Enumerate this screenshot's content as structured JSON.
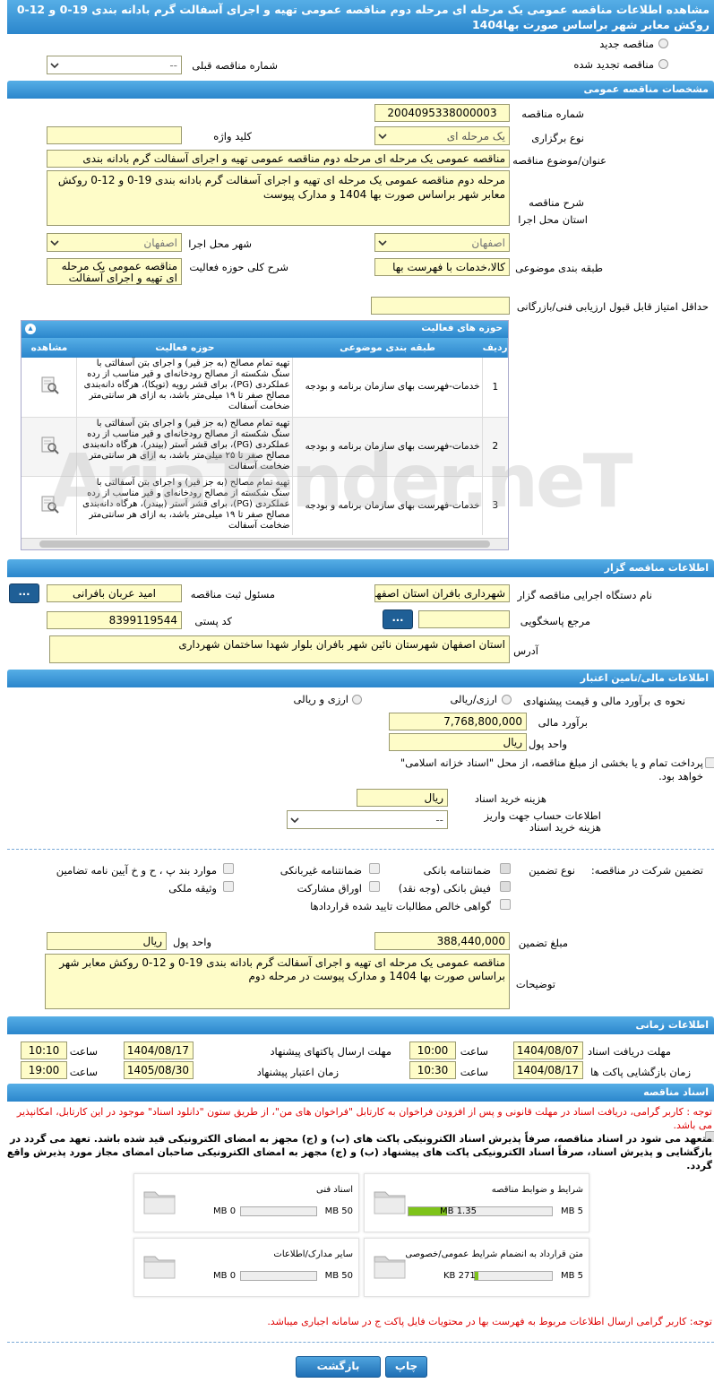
{
  "title": "مشاهده اطلاعات مناقصه عمومی یک مرحله ای مرحله دوم مناقصه عمومی تهیه و اجرای آسفالت گرم بادانه بندی 19-0 و 12-0 روکش معابر شهر براساس صورت بها1404",
  "top": {
    "new_label": "مناقصه جدید",
    "renewed_label": "مناقصه تجدید شده",
    "prev_label": "شماره مناقصه قبلی",
    "prev_value": "--"
  },
  "general": {
    "header": "مشخصات مناقصه عمومی",
    "number_label": "شماره مناقصه",
    "number": "2004095338000003",
    "type_label": "نوع برگزاری",
    "type": "یک مرحله ای",
    "keyword_label": "کلید واژه",
    "subject_label": "عنوان/موضوع مناقصه",
    "subject": "مناقصه عمومی یک مرحله ای مرحله دوم مناقصه عمومی تهیه و اجرای آسفالت گرم بادانه بندی",
    "desc_label": "شرح مناقصه",
    "desc": "مرحله دوم مناقصه عمومی یک مرحله ای تهیه و اجرای آسفالت گرم بادانه بندی 19-0 و 12-0 روکش معابر شهر براساس صورت بها 1404 و مدارک پیوست",
    "province_label": "استان محل اجرا",
    "province": "اصفهان",
    "city_label": "شهر محل اجرا",
    "city": "اصفهان",
    "category_label": "طبقه بندی موضوعی",
    "category": "کالا،خدمات با فهرست بها",
    "scope_label": "شرح کلی حوزه فعالیت",
    "scope": "مناقصه عمومی یک مرحله ای تهیه و اجرای آسفالت",
    "min_score_label": "حداقل امتیاز قابل قبول ارزیابی فنی/بازرگانی"
  },
  "activity": {
    "header": "حوزه های فعالیت",
    "col_row": "ردیف",
    "col_cat": "طبقه بندی موضوعی",
    "col_area": "حوزه فعالیت",
    "col_view": "مشاهده",
    "rows": [
      {
        "n": "1",
        "cat": "خدمات-فهرست بهای سازمان برنامه و بودجه",
        "area": "تهیه تمام مصالح (به جز قیر) و اجرای بتن آسفالتی با سنگ شکسته از مصالح رودخانه‌ای و قیر مناسب از رده عملکردی (PG)، برای قشر رویه (توپکا)، هرگاه دانه‌بندی مصالح صفر تا ۱۹ میلی‌متر باشد، به ازای هر سانتی‌متر ضخامت آسفالت"
      },
      {
        "n": "2",
        "cat": "خدمات-فهرست بهای سازمان برنامه و بودجه",
        "area": "تهیه تمام مصالح (به جز قیر) و اجرای بتن آسفالتی با سنگ شکسته از مصالح رودخانه‌ای و قیر مناسب از رده عملکردی (PG)، برای قشر آستر (بیندر)، هرگاه دانه‌بندی مصالح صفر تا ۲۵ میلی‌متر باشد، به ازای هر سانتی‌متر ضخامت آسفالت"
      },
      {
        "n": "3",
        "cat": "خدمات-فهرست بهای سازمان برنامه و بودجه",
        "area": "تهیه تمام مصالح (به جز قیر) و اجرای بتن آسفالتی با سنگ شکسته از مصالح رودخانه‌ای و قیر مناسب از رده عملکردی (PG)، برای قشر آستر (بیندر)، هرگاه دانه‌بندی مصالح صفر تا ۱۹ میلی‌متر باشد، به ازای هر سانتی‌متر ضخامت آسفالت"
      }
    ]
  },
  "organizer": {
    "header": "اطلاعات مناقصه گزار",
    "org_label": "نام دستگاه اجرایی مناقصه گزار",
    "org": "شهرداری بافران استان اصفهان",
    "resp_label": "مسئول ثبت مناقصه",
    "resp": "امید عربان بافرانی",
    "ref_label": "مرجع پاسخگویی",
    "postal_label": "کد پستی",
    "postal": "8399119544",
    "addr_label": "آدرس",
    "addr": "استان اصفهان شهرستان نائین شهر بافران بلوار شهدا ساختمان شهرداری",
    "dots": "..."
  },
  "finance": {
    "header": "اطلاعات مالی/تامین اعتبار",
    "method_label": "نحوه ی برآورد مالی و قیمت پیشنهادی",
    "opt1": "ارزی/ریالی",
    "opt2": "ارزی و ریالی",
    "estimate_label": "برآورد مالی",
    "estimate": "7,768,800,000",
    "unit_label": "واحد پول",
    "unit": "ریال",
    "treasury": "پرداخت تمام و یا بخشی از مبلغ مناقصه، از محل \"اسناد خزانه اسلامی\" خواهد بود.",
    "fee_label": "هزینه خرید اسناد",
    "fee": "ریال",
    "account_label": "اطلاعات حساب جهت واریز هزینه خرید اسناد",
    "account": "--"
  },
  "guarantee": {
    "label": "تضمین شرکت در مناقصه:",
    "type_label": "نوع تضمین",
    "items": [
      "ضمانتنامه بانکی",
      "ضمانتنامه غیربانکی",
      "موارد بند پ ، ح و خ آیین نامه تضامین",
      "فیش بانکی (وجه نقد)",
      "اوراق مشارکت",
      "وثیقه ملکی",
      "گواهی خالص مطالبات تایید شده قراردادها"
    ],
    "amount_label": "مبلغ تضمین",
    "amount": "388,440,000",
    "unit_label": "واحد پول",
    "unit": "ریال",
    "notes_label": "توضیحات",
    "notes": "مناقصه عمومی یک مرحله ای تهیه و اجرای آسفالت گرم بادانه بندی 19-0 و 12-0 روکش معابر شهر براساس صورت بها 1404 و مدارک پیوست در مرحله دوم"
  },
  "timing": {
    "header": "اطلاعات زمانی",
    "doc_recv_label": "مهلت دریافت اسناد",
    "doc_recv_date": "1404/08/07",
    "doc_recv_time": "10:00",
    "send_label": "مهلت ارسال پاکتهای پیشنهاد",
    "send_date": "1404/08/17",
    "send_time": "10:10",
    "open_label": "زمان بازگشایی پاکت ها",
    "open_date": "1404/08/17",
    "open_time": "10:30",
    "valid_label": "زمان اعتبار پیشنهاد",
    "valid_date": "1405/08/30",
    "valid_time": "19:00",
    "time_label": "ساعت"
  },
  "docs": {
    "header": "اسناد مناقصه",
    "note1": "توجه : کاربر گرامی، دریافت اسناد در مهلت قانونی و پس از افزودن فراخوان به کارتابل \"فراخوان های من\"، از طریق ستون \"دانلود اسناد\" موجود در این کارتابل، امکانپذیر می باشد.",
    "commit": "متعهد می شود در اسناد مناقصه، صرفاً پذیرش اسناد الکترونیکی پاکت های (ب) و (ج) مجهز به امضای الکترونیکی قید شده باشد. تعهد می گردد در بازگشایی و پذیرش اسناد، صرفاً اسناد الکترونیکی پاکت های پیشنهاد (ب) و (ج) مجهز به امضای الکترونیکی صاحبان امضای مجاز مورد پذیرش واقع گردد.",
    "files": [
      {
        "name": "شرایط و ضوابط مناقصه",
        "used": "1.35 MB",
        "max": "5 MB",
        "pct": 0.27
      },
      {
        "name": "اسناد فنی",
        "used": "0 MB",
        "max": "50 MB",
        "pct": 0
      },
      {
        "name": "متن قرارداد به انضمام شرایط عمومی/خصوصی",
        "used": "271 KB",
        "max": "5 MB",
        "pct": 0.05
      },
      {
        "name": "سایر مدارک/اطلاعات",
        "used": "0 MB",
        "max": "50 MB",
        "pct": 0
      }
    ],
    "note2": "توجه: کاربر گرامی ارسال اطلاعات مربوط به فهرست بها در محتویات فایل پاکت ج در سامانه اجباری میباشد."
  },
  "buttons": {
    "print": "چاپ",
    "back": "بازگشت"
  },
  "watermark": "AriaTender.neT"
}
